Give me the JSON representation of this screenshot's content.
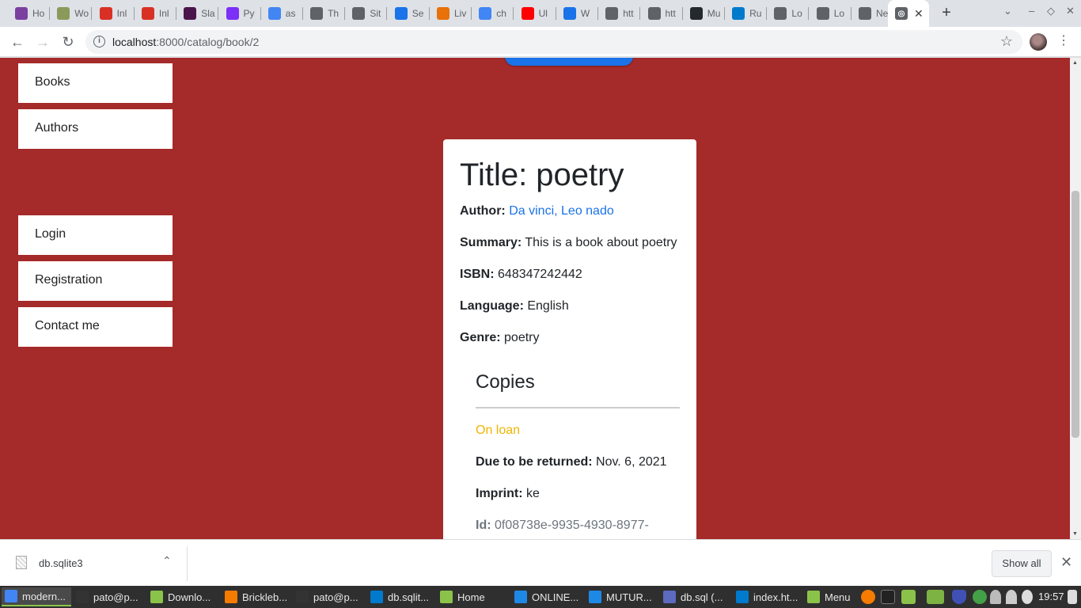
{
  "browser": {
    "tabs": [
      {
        "title": "Ho",
        "icon": "app-icon",
        "color": "#7b3fa0"
      },
      {
        "title": "Wo",
        "icon": "plant-icon",
        "color": "#8a9a5b"
      },
      {
        "title": "Inl",
        "icon": "gmail-icon",
        "color": "#d93025"
      },
      {
        "title": "Inl",
        "icon": "gmail-icon",
        "color": "#d93025"
      },
      {
        "title": "Sla",
        "icon": "slack-icon",
        "color": "#4a154b"
      },
      {
        "title": "Py",
        "icon": "pycharm-icon",
        "color": "#7b2ff7"
      },
      {
        "title": "as",
        "icon": "google-icon",
        "color": "#4285f4"
      },
      {
        "title": "Th",
        "icon": "globe-icon",
        "color": "#5f6368"
      },
      {
        "title": "Sit",
        "icon": "globe-icon",
        "color": "#5f6368"
      },
      {
        "title": "Se",
        "icon": "gear-icon",
        "color": "#1a73e8"
      },
      {
        "title": "Liv",
        "icon": "app-icon",
        "color": "#e8710a"
      },
      {
        "title": "ch",
        "icon": "google-icon",
        "color": "#4285f4"
      },
      {
        "title": "Ul",
        "icon": "youtube-icon",
        "color": "#ff0000"
      },
      {
        "title": "W",
        "icon": "app-icon",
        "color": "#1a73e8"
      },
      {
        "title": "htt",
        "icon": "globe-icon",
        "color": "#5f6368"
      },
      {
        "title": "htt",
        "icon": "globe-icon",
        "color": "#5f6368"
      },
      {
        "title": "Mu",
        "icon": "github-icon",
        "color": "#24292e"
      },
      {
        "title": "Ru",
        "icon": "vscode-icon",
        "color": "#007acc"
      },
      {
        "title": "Lo",
        "icon": "globe-icon",
        "color": "#5f6368"
      },
      {
        "title": "Lo",
        "icon": "globe-icon",
        "color": "#5f6368"
      },
      {
        "title": "Ne",
        "icon": "chrome-icon",
        "color": "#5f6368"
      }
    ],
    "active_tab": {
      "icon": "globe-icon"
    },
    "url_host": "localhost",
    "url_path": ":8000/catalog/book/2"
  },
  "sidebar": {
    "top_links": [
      "Books",
      "Authors"
    ],
    "bottom_links": [
      "Login",
      "Registration",
      "Contact me"
    ]
  },
  "book": {
    "title": "Title: poetry",
    "author_label": "Author:",
    "author_value": "Da vinci, Leo nado",
    "summary_label": "Summary:",
    "summary_value": "This is a book about poetry",
    "isbn_label": "ISBN:",
    "isbn_value": "648347242442",
    "language_label": "Language:",
    "language_value": "English",
    "genre_label": "Genre:",
    "genre_value": "poetry"
  },
  "copies": {
    "heading": "Copies",
    "status": "On loan",
    "due_label": "Due to be returned:",
    "due_value": "Nov. 6, 2021",
    "imprint_label": "Imprint:",
    "imprint_value": "ke",
    "id_label": "Id:",
    "id_value": "0f08738e-9935-4930-8977-"
  },
  "downloads": {
    "file_name": "db.sqlite3",
    "show_all": "Show all"
  },
  "taskbar": {
    "items": [
      "modern...",
      "pato@p...",
      "Downlo...",
      "Brickleb...",
      "pato@p...",
      "db.sqlit...",
      "Home",
      "ONLINE...",
      "MUTUR...",
      "db.sql (...",
      "index.ht..."
    ],
    "item_colors": [
      "#4285f4",
      "#333333",
      "#8bc34a",
      "#f57c00",
      "#333333",
      "#007acc",
      "#8bc34a",
      "#1e88e5",
      "#1e88e5",
      "#5c6bc0",
      "#007acc"
    ],
    "menu_label": "Menu",
    "clock": "19:57"
  },
  "colors": {
    "page_background": "#a52a2a",
    "link": "#1a73e8",
    "on_loan": "#f0b400"
  }
}
